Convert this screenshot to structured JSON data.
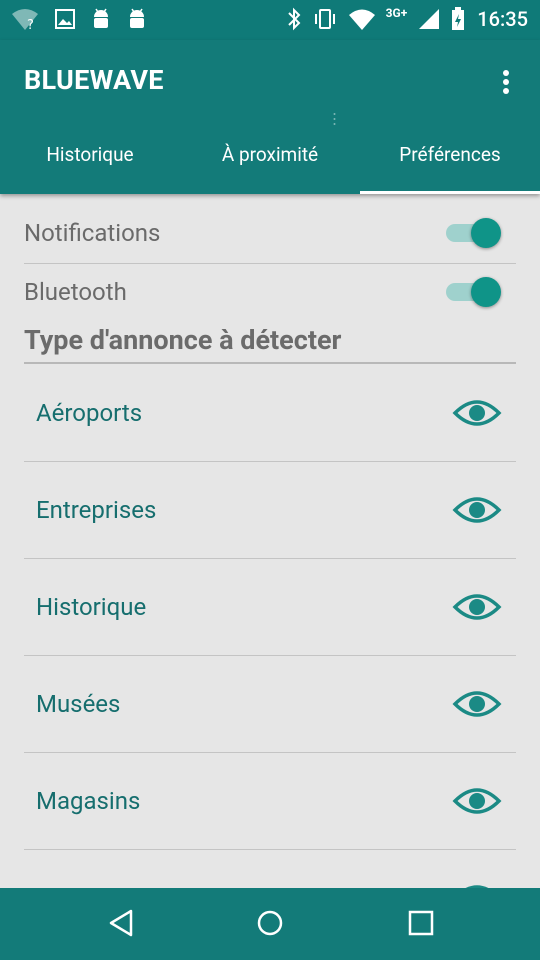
{
  "status_bar": {
    "time": "16:35",
    "network": "3G+",
    "left_icons": [
      "wifi-question-icon",
      "image-icon",
      "android-icon",
      "android-icon"
    ],
    "right_icons": [
      "bluetooth-icon",
      "vibrate-icon",
      "wifi-icon",
      "signal-icon",
      "battery-icon"
    ]
  },
  "app_bar": {
    "title": "BLUEWAVE",
    "overflow_icon": "more-vert-icon"
  },
  "tabs": [
    {
      "label": "Historique",
      "active": false
    },
    {
      "label": "À proximité",
      "active": false
    },
    {
      "label": "Préférences",
      "active": true
    }
  ],
  "preferences": [
    {
      "label": "Notifications",
      "enabled": true
    },
    {
      "label": "Bluetooth",
      "enabled": true
    }
  ],
  "section": {
    "title": "Type d'annonce à détecter"
  },
  "categories": [
    {
      "label": "Aéroports",
      "icon": "eye-icon"
    },
    {
      "label": "Entreprises",
      "icon": "eye-icon"
    },
    {
      "label": "Historique",
      "icon": "eye-icon"
    },
    {
      "label": "Musées",
      "icon": "eye-icon"
    },
    {
      "label": "Magasins",
      "icon": "eye-icon"
    }
  ],
  "nav_bar": {
    "buttons": [
      "back-icon",
      "home-icon",
      "recents-icon"
    ]
  },
  "colors": {
    "primary": "#137b79",
    "accent": "#0f9488",
    "category_text": "#166e6e",
    "background": "#e6e6e6"
  }
}
